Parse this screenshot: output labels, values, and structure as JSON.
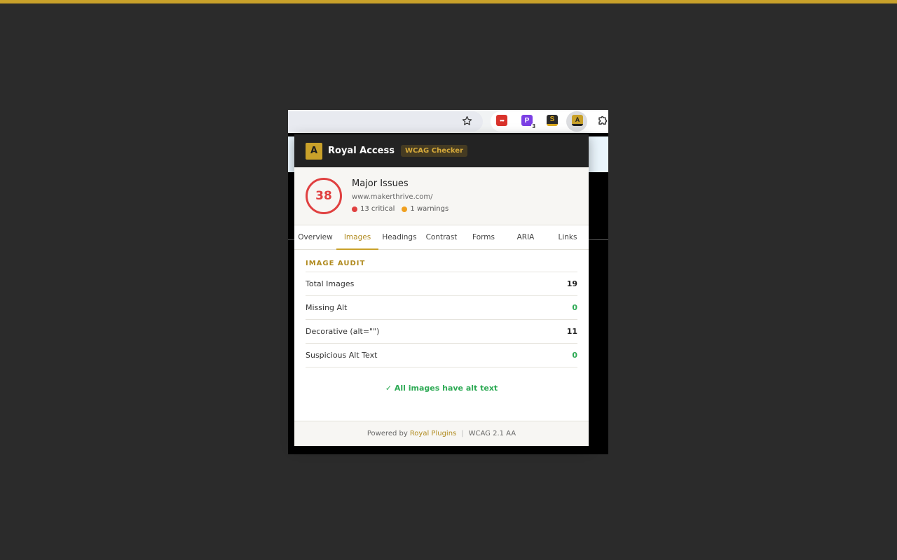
{
  "extension": {
    "brand": "Royal Access",
    "logo_letter": "A",
    "tag": "WCAG Checker"
  },
  "toolbar": {
    "extensions": [
      {
        "name": "password-manager",
        "label": "•••",
        "color": "#d9322b"
      },
      {
        "name": "purple-extension",
        "label": "P",
        "badge": "3",
        "color": "#7b3fe4"
      },
      {
        "name": "s-extension",
        "label": "S",
        "color": "#2a2a2a"
      },
      {
        "name": "royal-access",
        "label": "A",
        "color": "#c9a12a"
      }
    ]
  },
  "summary": {
    "score": "38",
    "status": "Major Issues",
    "url": "www.makerthrive.com/",
    "critical": "13 critical",
    "warnings": "1 warnings"
  },
  "tabs": [
    "Overview",
    "Images",
    "Headings",
    "Contrast",
    "Forms",
    "ARIA",
    "Links"
  ],
  "active_tab": "Images",
  "audit": {
    "title": "IMAGE AUDIT",
    "rows": [
      {
        "label": "Total Images",
        "value": "19"
      },
      {
        "label": "Missing Alt",
        "value": "0"
      },
      {
        "label": "Decorative (alt=\"\")",
        "value": "11"
      },
      {
        "label": "Suspicious Alt Text",
        "value": "0"
      }
    ],
    "message": "✓ All images have alt text"
  },
  "footer": {
    "powered_by": "Powered by",
    "link": "Royal Plugins",
    "standard": "WCAG 2.1 AA"
  },
  "colors": {
    "accent": "#c9a12a",
    "critical": "#e04040",
    "warning": "#f0a020",
    "success": "#2eaa55"
  }
}
